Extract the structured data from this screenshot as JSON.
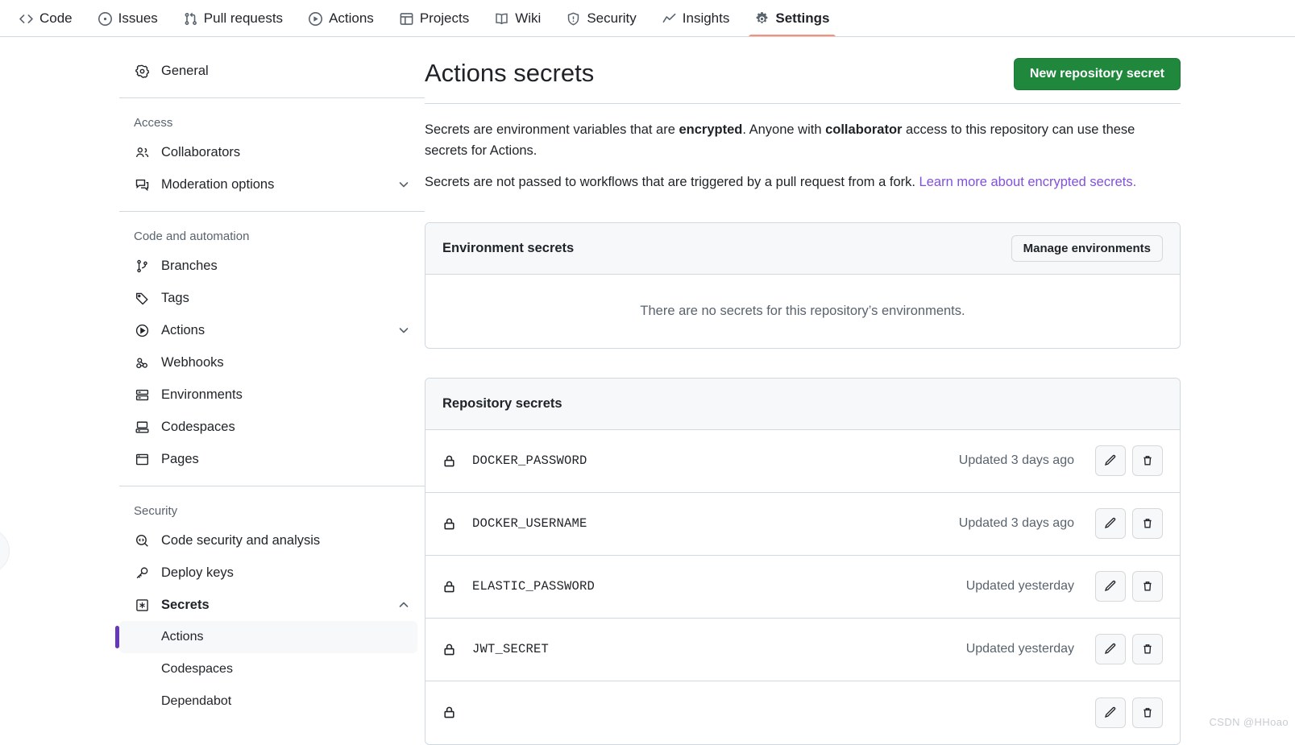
{
  "topnav": {
    "tabs": [
      {
        "label": "Code",
        "icon": "code-icon",
        "selected": false
      },
      {
        "label": "Issues",
        "icon": "issue-opened-icon",
        "selected": false
      },
      {
        "label": "Pull requests",
        "icon": "git-pull-request-icon",
        "selected": false
      },
      {
        "label": "Actions",
        "icon": "play-icon",
        "selected": false
      },
      {
        "label": "Projects",
        "icon": "table-icon",
        "selected": false
      },
      {
        "label": "Wiki",
        "icon": "book-icon",
        "selected": false
      },
      {
        "label": "Security",
        "icon": "shield-icon",
        "selected": false
      },
      {
        "label": "Insights",
        "icon": "graph-icon",
        "selected": false
      },
      {
        "label": "Settings",
        "icon": "gear-icon",
        "selected": true
      }
    ],
    "accent_underline": "#fd8c73"
  },
  "sidebar": {
    "general": {
      "label": "General",
      "icon": "gear-icon"
    },
    "sections": [
      {
        "label": "Access",
        "items": [
          {
            "label": "Collaborators",
            "icon": "people-icon",
            "chevron": null
          },
          {
            "label": "Moderation options",
            "icon": "comment-discussion-icon",
            "chevron": "chevron-down-icon"
          }
        ]
      },
      {
        "label": "Code and automation",
        "items": [
          {
            "label": "Branches",
            "icon": "git-branch-icon",
            "chevron": null
          },
          {
            "label": "Tags",
            "icon": "tag-icon",
            "chevron": null
          },
          {
            "label": "Actions",
            "icon": "play-icon",
            "chevron": "chevron-down-icon"
          },
          {
            "label": "Webhooks",
            "icon": "webhook-icon",
            "chevron": null
          },
          {
            "label": "Environments",
            "icon": "server-icon",
            "chevron": null
          },
          {
            "label": "Codespaces",
            "icon": "codespaces-icon",
            "chevron": null
          },
          {
            "label": "Pages",
            "icon": "browser-icon",
            "chevron": null
          }
        ]
      },
      {
        "label": "Security",
        "items": [
          {
            "label": "Code security and analysis",
            "icon": "codescan-icon",
            "chevron": null
          },
          {
            "label": "Deploy keys",
            "icon": "key-icon",
            "chevron": null
          },
          {
            "label": "Secrets",
            "icon": "asterisk-box-icon",
            "chevron": "chevron-up-icon",
            "bold": true
          }
        ],
        "subitems": [
          {
            "label": "Actions",
            "active": true
          },
          {
            "label": "Codespaces",
            "active": false
          },
          {
            "label": "Dependabot",
            "active": false
          }
        ]
      }
    ],
    "active_indicator_color": "#6639ba"
  },
  "main": {
    "title": "Actions secrets",
    "new_secret_button": "New repository secret",
    "new_secret_button_color": "#1f883d",
    "intro_p1_a": "Secrets are environment variables that are ",
    "intro_p1_b": "encrypted",
    "intro_p1_c": ". Anyone with ",
    "intro_p1_d": "collaborator",
    "intro_p1_e": " access to this repository can use these secrets for Actions.",
    "intro_p2_a": "Secrets are not passed to workflows that are triggered by a pull request from a fork. ",
    "intro_p2_link": "Learn more about encrypted secrets.",
    "link_color": "#8250df",
    "environment_card": {
      "title": "Environment secrets",
      "manage_button": "Manage environments",
      "empty_text": "There are no secrets for this repository’s environments."
    },
    "repository_card": {
      "title": "Repository secrets",
      "rows": [
        {
          "name": "DOCKER_PASSWORD",
          "updated": "Updated 3 days ago"
        },
        {
          "name": "DOCKER_USERNAME",
          "updated": "Updated 3 days ago"
        },
        {
          "name": "ELASTIC_PASSWORD",
          "updated": "Updated yesterday"
        },
        {
          "name": "JWT_SECRET",
          "updated": "Updated yesterday"
        }
      ],
      "edit_icon": "pencil-icon",
      "delete_icon": "trash-icon"
    }
  },
  "watermark": "CSDN @HHoao"
}
